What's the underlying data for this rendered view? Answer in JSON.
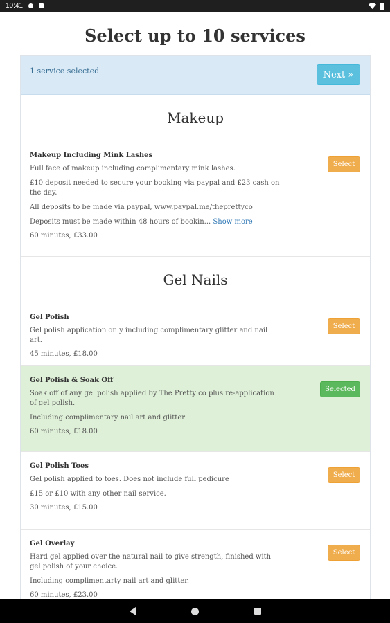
{
  "status": {
    "time": "10:41",
    "battery_icon": "battery-icon",
    "wifi_icon": "wifi-icon"
  },
  "page": {
    "title": "Select up to 10 services"
  },
  "selection": {
    "count_text": "1 service selected",
    "next_label": "Next »"
  },
  "categories": [
    {
      "title": "Makeup",
      "services": [
        {
          "name": "Makeup Including Mink Lashes",
          "lines": [
            "Full face of makeup including complimentary mink lashes.",
            "£10 deposit needed to secure your booking via paypal and £23 cash on the day.",
            "All deposits to be made via paypal, www.paypal.me/theprettyco",
            "Deposits must be made within 48 hours of bookin..."
          ],
          "show_more": "Show more",
          "meta": "60 minutes, £33.00",
          "button": "Select"
        }
      ]
    },
    {
      "title": "Gel Nails",
      "services": [
        {
          "name": "Gel Polish",
          "lines": [
            "Gel polish application only including complimentary glitter and nail art."
          ],
          "meta": "45 minutes, £18.00",
          "button": "Select"
        },
        {
          "name": "Gel Polish & Soak Off",
          "lines": [
            "Soak off of any gel polish applied by The Pretty co plus re-application of gel polish.",
            "Including complimentary nail art and glitter"
          ],
          "meta": "60 minutes, £18.00",
          "button": "Selected"
        },
        {
          "name": "Gel Polish Toes",
          "lines": [
            "Gel polish applied to toes. Does not include full pedicure",
            "£15 or £10 with any other nail service."
          ],
          "meta": "30 minutes, £15.00",
          "button": "Select"
        },
        {
          "name": "Gel Overlay",
          "lines": [
            "Hard gel applied over the natural nail to give strength, finished with gel polish of your choice.",
            "Including complimentarty nail art and glitter."
          ],
          "meta": "60 minutes, £23.00",
          "button": "Select"
        }
      ]
    }
  ],
  "colors": {
    "select": "#f0ad4e",
    "selected": "#5cb85c",
    "next": "#5bc0de",
    "selected_row": "#dff0d8",
    "header_bar": "#d9eaf6"
  }
}
